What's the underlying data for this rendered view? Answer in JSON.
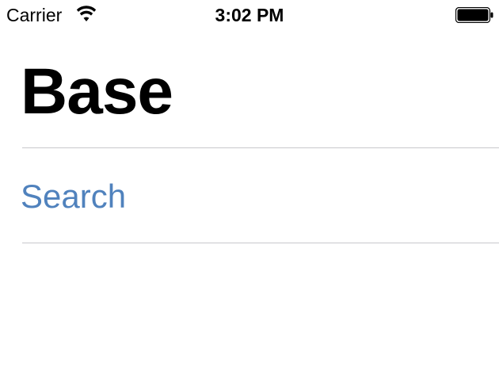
{
  "status_bar": {
    "carrier": "Carrier",
    "time": "3:02 PM",
    "wifi_icon": "wifi-icon",
    "battery_icon": "battery-icon"
  },
  "page": {
    "title": "Base",
    "search_label": "Search"
  },
  "colors": {
    "link": "#5082bd",
    "divider": "#c8c8cc",
    "text": "#000000",
    "background": "#ffffff"
  }
}
